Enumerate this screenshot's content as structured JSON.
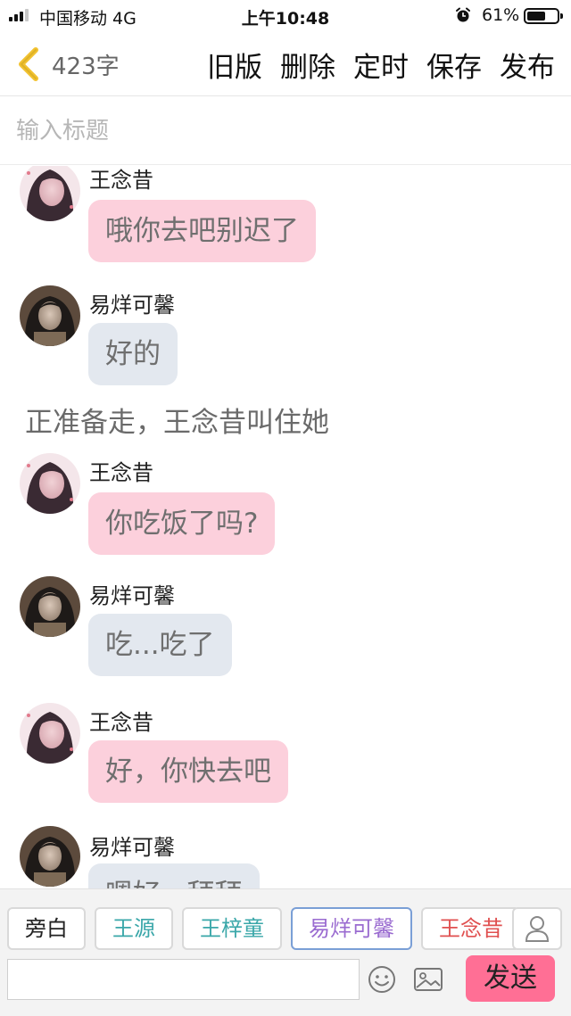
{
  "status_bar": {
    "carrier": "中国移动  4G",
    "time": "上午10:48",
    "battery_text": "61%",
    "battery_level": 0.61,
    "signal_bars": 3,
    "icons": [
      "signal-icon",
      "alarm-icon",
      "battery-icon"
    ]
  },
  "nav": {
    "back_icon": "chevron-left-icon",
    "char_count": "423字",
    "actions": [
      "旧版",
      "删除",
      "定时",
      "保存",
      "发布"
    ]
  },
  "title_input": {
    "placeholder": "输入标题",
    "value": ""
  },
  "chat": {
    "messages": [
      {
        "type": "message",
        "sender": "王念昔",
        "text": "哦你去吧别迟了",
        "bubble": "pink",
        "avatar": "avatar-wangnianxi"
      },
      {
        "type": "message",
        "sender": "易烊可馨",
        "text": "好的",
        "bubble": "gray",
        "avatar": "avatar-yiyangkexin"
      },
      {
        "type": "narration",
        "text": "正准备走，王念昔叫住她"
      },
      {
        "type": "message",
        "sender": "王念昔",
        "text": "你吃饭了吗?",
        "bubble": "pink",
        "avatar": "avatar-wangnianxi"
      },
      {
        "type": "message",
        "sender": "易烊可馨",
        "text": "吃...吃了",
        "bubble": "gray",
        "avatar": "avatar-yiyangkexin"
      },
      {
        "type": "message",
        "sender": "王念昔",
        "text": "好，你快去吧",
        "bubble": "pink",
        "avatar": "avatar-wangnianxi"
      },
      {
        "type": "message",
        "sender": "易烊可馨",
        "text": "嗯好...拜拜",
        "bubble": "gray",
        "avatar": "avatar-yiyangkexin"
      }
    ]
  },
  "bottom": {
    "roles": [
      {
        "label": "旁白",
        "color": "#222222",
        "selected": false
      },
      {
        "label": "王源",
        "color": "#3aa7a9",
        "selected": false
      },
      {
        "label": "王梓童",
        "color": "#3aa7a9",
        "selected": false
      },
      {
        "label": "易烊可馨",
        "color": "#9a6bd0",
        "selected": true
      },
      {
        "label": "王念昔",
        "color": "#e05050",
        "selected": false
      }
    ],
    "role_user_icon": "user-icon",
    "input_value": "",
    "emoji_icon": "smiley-icon",
    "image_icon": "image-icon",
    "send_label": "发送",
    "send_color": "#ff6f95"
  },
  "colors": {
    "bubble_pink": "#fcd0dc",
    "bubble_gray": "#e3e8ef",
    "back_arrow": "#f2c230"
  }
}
